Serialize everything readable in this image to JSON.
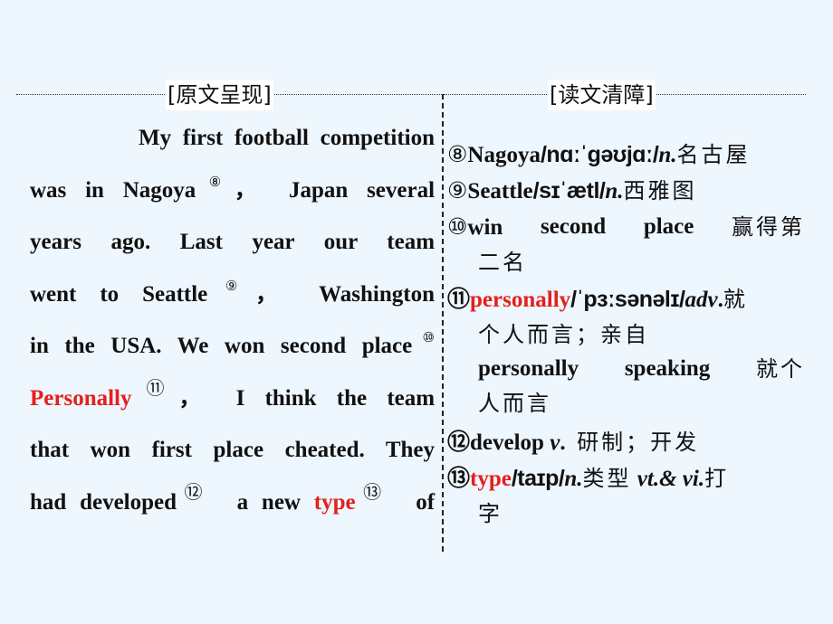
{
  "headers": {
    "left": "[原文呈现]",
    "right": "[读文清障]"
  },
  "passage": {
    "lines": [
      [
        "My",
        "first",
        "football",
        "competition"
      ],
      [
        "was",
        "in",
        "Nagoya",
        "Japan",
        "several"
      ],
      [
        "years",
        "ago.",
        "Last",
        "year",
        "our",
        "team"
      ],
      [
        "went",
        "to",
        "Seattle",
        "Washington"
      ],
      [
        "in the USA. We won second place"
      ],
      [
        "Personally",
        "I",
        "think",
        "the",
        "team"
      ],
      [
        "that",
        "won",
        "first",
        "place",
        "cheated.",
        "They"
      ],
      [
        "had developed",
        "a new",
        "type",
        "of"
      ]
    ],
    "marks": {
      "m8": "⑧",
      "m9": "⑨",
      "m10": "⑩",
      "m11": "⑪",
      "m12": "⑫",
      "m13": "⑬"
    },
    "comma": "，",
    "highlight_color": "#e4201c"
  },
  "notes": [
    {
      "num": "⑧",
      "word": "Nagoya",
      "ipa": "/nɑːˈɡəʊjɑː/",
      "pos": "n.",
      "cn": "名古屋"
    },
    {
      "num": "⑨",
      "word": "Seattle",
      "ipa": "/sɪˈætl/",
      "pos": "n.",
      "cn": "西雅图"
    },
    {
      "num": "⑩",
      "word": "win",
      "w2": "second",
      "w3": "place",
      "cn1": "赢得第",
      "cn2": "二名"
    },
    {
      "num": "⑪",
      "word": "personally",
      "ipa": "/ˈpɜːsənəlɪ/",
      "pos": "adv",
      "dot": ".",
      "cn1": "就",
      "cn2": "个人而言；亲自",
      "phrase": "personally",
      "phrase2": "speaking",
      "pcn1": "就个",
      "pcn2": "人而言"
    },
    {
      "num": "⑫",
      "word": "develop",
      "pos": "v",
      "dot": ".",
      "cn": "研制；开发"
    },
    {
      "num": "⑬",
      "word": "type",
      "ipa": "/taɪp/",
      "pos": "n.",
      "cn": "类型",
      "pos2": "vt.&",
      "pos3": "vi.",
      "cn1": "打",
      "cn2": "字"
    }
  ]
}
